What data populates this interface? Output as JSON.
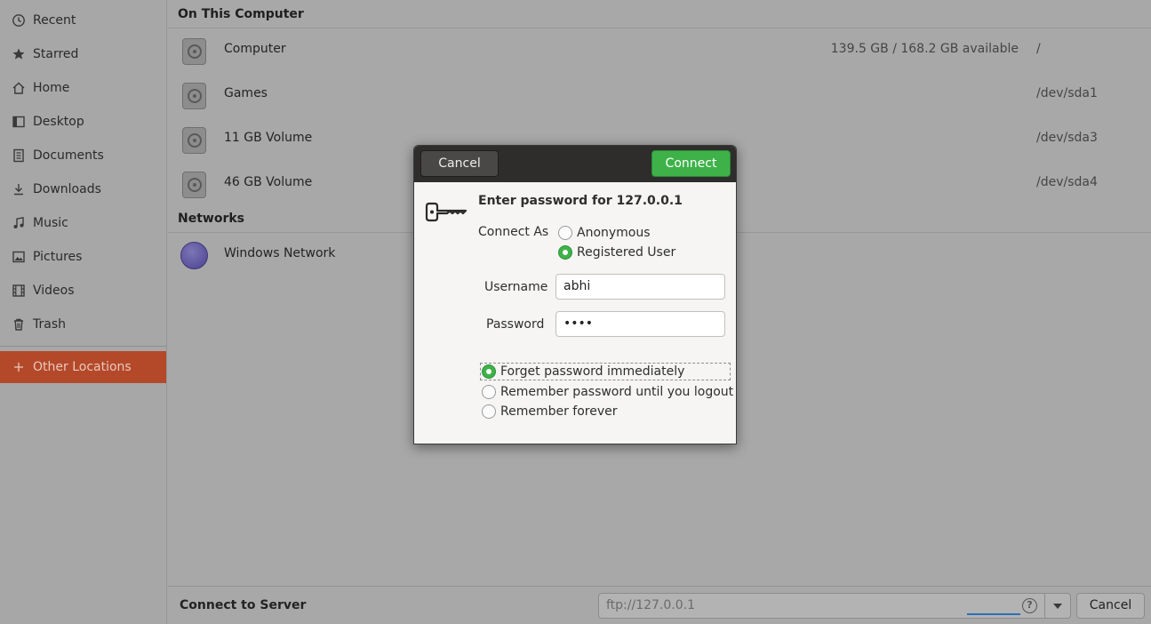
{
  "sidebar": {
    "items": [
      {
        "label": "Recent",
        "icon": "clock-icon"
      },
      {
        "label": "Starred",
        "icon": "star-icon"
      },
      {
        "label": "Home",
        "icon": "home-icon"
      },
      {
        "label": "Desktop",
        "icon": "desktop-icon"
      },
      {
        "label": "Documents",
        "icon": "document-icon"
      },
      {
        "label": "Downloads",
        "icon": "download-icon"
      },
      {
        "label": "Music",
        "icon": "music-icon"
      },
      {
        "label": "Pictures",
        "icon": "picture-icon"
      },
      {
        "label": "Videos",
        "icon": "video-icon"
      },
      {
        "label": "Trash",
        "icon": "trash-icon"
      }
    ],
    "other_locations": {
      "label": "Other Locations",
      "icon": "plus-icon"
    },
    "active_color": "#b4492a"
  },
  "main": {
    "on_this_computer_title": "On This Computer",
    "drives": [
      {
        "name": "Computer",
        "available": "139.5 GB / 168.2 GB available",
        "path": "/"
      },
      {
        "name": "Games",
        "available": "",
        "path": "/dev/sda1"
      },
      {
        "name": "11 GB Volume",
        "available": "",
        "path": "/dev/sda3"
      },
      {
        "name": "46 GB Volume",
        "available": "",
        "path": "/dev/sda4"
      }
    ],
    "networks_title": "Networks",
    "networks": [
      {
        "name": "Windows Network"
      }
    ]
  },
  "bottom_bar": {
    "label": "Connect to Server",
    "url_value": "ftp://127.0.0.1",
    "help_glyph": "?",
    "cancel_label": "Cancel"
  },
  "dialog": {
    "cancel_label": "Cancel",
    "connect_label": "Connect",
    "connect_color": "#3eb249",
    "prompt": "Enter password for 127.0.0.1",
    "connect_as_label": "Connect As",
    "connect_as_options": [
      {
        "label": "Anonymous",
        "selected": false
      },
      {
        "label": "Registered User",
        "selected": true
      }
    ],
    "username_label": "Username",
    "username_value": "abhi",
    "password_label": "Password",
    "password_value": "••••",
    "remember_options": [
      {
        "label": "Forget password immediately",
        "selected": true
      },
      {
        "label": "Remember password until you logout",
        "selected": false
      },
      {
        "label": "Remember forever",
        "selected": false
      }
    ]
  }
}
